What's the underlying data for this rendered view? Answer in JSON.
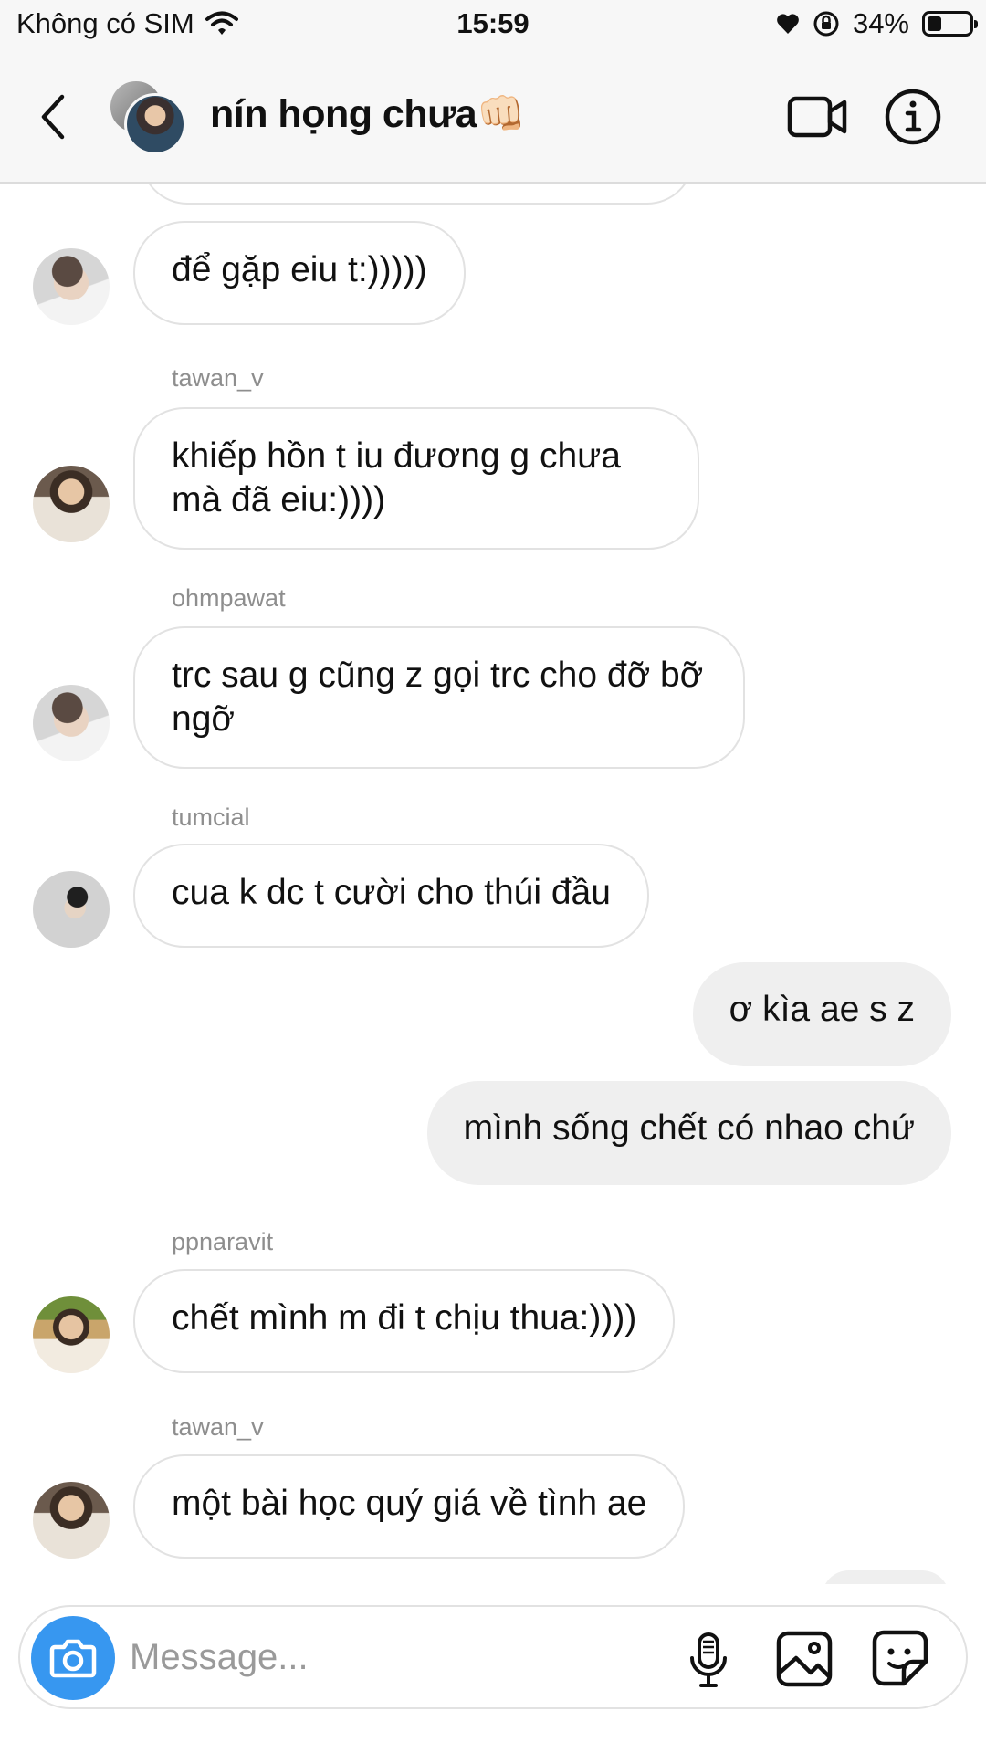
{
  "status_bar": {
    "carrier": "Không có SIM",
    "time": "15:59",
    "battery_percent_label": "34%",
    "battery_level": 0.34,
    "icons": [
      "wifi-icon",
      "heart-icon",
      "orientation-lock-icon",
      "battery-icon"
    ]
  },
  "header": {
    "title": "nín họng chưa👊🏻",
    "icons": [
      "back-chevron-icon",
      "video-call-icon",
      "info-icon"
    ]
  },
  "messages": [
    {
      "type": "in",
      "text": "để gặp eiu t:)))))"
    },
    {
      "type": "in",
      "sender": "tawan_v",
      "text": "khiếp hồn t iu đương g chưa mà đã eiu:))))"
    },
    {
      "type": "in",
      "sender": "ohmpawat",
      "text": "trc sau g cũng z gọi trc cho đỡ bỡ ngỡ"
    },
    {
      "type": "in",
      "sender": "tumcial",
      "text": "cua k dc t cười cho thúi đầu"
    },
    {
      "type": "out",
      "text": "ơ kìa ae s z"
    },
    {
      "type": "out",
      "text": "mình sống chết có nhao chứ"
    },
    {
      "type": "in",
      "sender": "ppnaravit",
      "text": "chết mình m đi t chịu thua:))))"
    },
    {
      "type": "in",
      "sender": "tawan_v",
      "text": "một bài học quý giá về tình ae"
    }
  ],
  "composer": {
    "placeholder": "Message...",
    "value": "",
    "accent_color": "#3797f0",
    "icons": [
      "camera-icon",
      "microphone-icon",
      "gallery-icon",
      "sticker-icon"
    ]
  }
}
